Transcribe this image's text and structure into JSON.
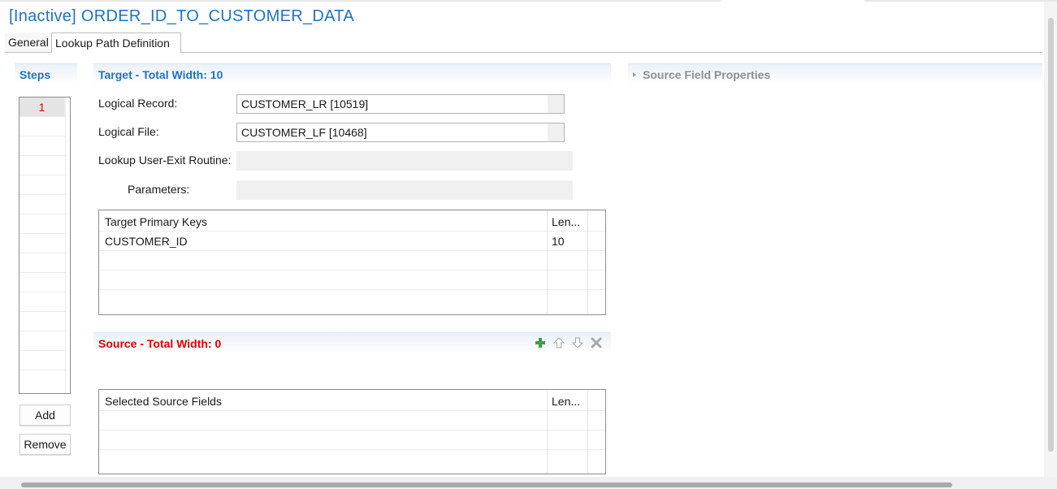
{
  "editor": {
    "title": "[Inactive] ORDER_ID_TO_CUSTOMER_DATA",
    "tabs": [
      {
        "label": "General",
        "selected": false
      },
      {
        "label": "Lookup Path Definition",
        "selected": true
      }
    ]
  },
  "steps": {
    "header": "Steps",
    "items": [
      "1"
    ],
    "add_label": "Add",
    "remove_label": "Remove"
  },
  "target": {
    "header": "Target - Total Width: 10",
    "logical_record_label": "Logical Record:",
    "logical_record_value": "CUSTOMER_LR [10519]",
    "logical_file_label": "Logical File:",
    "logical_file_value": "CUSTOMER_LF [10468]",
    "user_exit_label": "Lookup User-Exit Routine:",
    "user_exit_value": "",
    "parameters_label": "Parameters:",
    "parameters_value": "",
    "keys_table": {
      "columns": [
        "Target Primary Keys",
        "Len..."
      ],
      "rows": [
        {
          "field": "CUSTOMER_ID",
          "length": "10"
        }
      ]
    }
  },
  "source": {
    "header": "Source - Total Width: 0",
    "toolbar_icons": [
      "add-icon",
      "move-up-icon",
      "move-down-icon",
      "delete-icon"
    ],
    "fields_table": {
      "columns": [
        "Selected Source Fields",
        "Len..."
      ],
      "rows": []
    }
  },
  "source_field_properties": {
    "header": "Source Field Properties"
  },
  "colors": {
    "title_blue": "#1f72c4",
    "source_red": "#e00000",
    "add_green": "#3fa03f"
  }
}
